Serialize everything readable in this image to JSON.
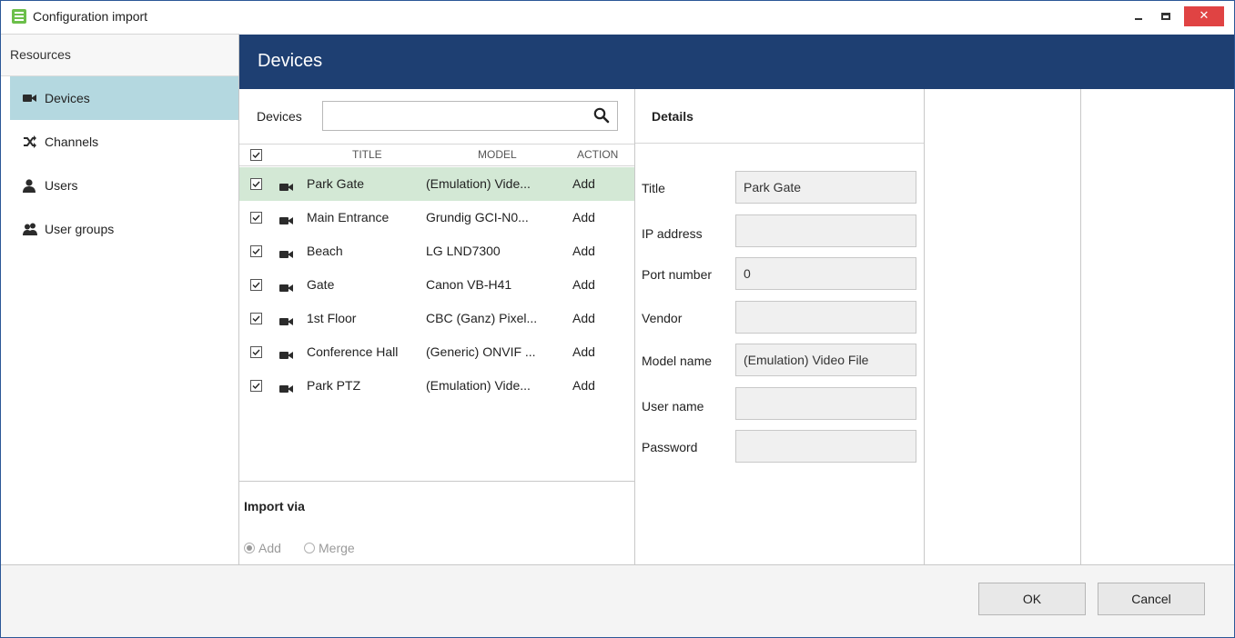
{
  "window": {
    "title": "Configuration import",
    "close_glyph": "✕"
  },
  "sidebar": {
    "header": "Resources",
    "items": [
      {
        "label": "Devices",
        "icon": "camera-icon"
      },
      {
        "label": "Channels",
        "icon": "shuffle-icon"
      },
      {
        "label": "Users",
        "icon": "user-icon"
      },
      {
        "label": "User groups",
        "icon": "user-group-icon"
      }
    ]
  },
  "main": {
    "title": "Devices"
  },
  "devices": {
    "search_label": "Devices",
    "search_value": "",
    "columns": {
      "title": "TITLE",
      "model": "MODEL",
      "action": "ACTION"
    },
    "rows": [
      {
        "title": "Park Gate",
        "model": "(Emulation) Vide...",
        "action": "Add"
      },
      {
        "title": "Main Entrance",
        "model": "Grundig GCI-N0...",
        "action": "Add"
      },
      {
        "title": "Beach",
        "model": "LG LND7300",
        "action": "Add"
      },
      {
        "title": "Gate",
        "model": "Canon VB-H41",
        "action": "Add"
      },
      {
        "title": "1st Floor",
        "model": "CBC (Ganz) Pixel...",
        "action": "Add"
      },
      {
        "title": "Conference Hall",
        "model": "(Generic) ONVIF ...",
        "action": "Add"
      },
      {
        "title": "Park PTZ",
        "model": "(Emulation) Vide...",
        "action": "Add"
      }
    ],
    "import": {
      "title": "Import via",
      "add_label": "Add",
      "merge_label": "Merge",
      "selected": "Add"
    }
  },
  "details": {
    "title": "Details",
    "fields": [
      {
        "label": "Title",
        "value": "Park Gate"
      },
      {
        "label": "IP address",
        "value": ""
      },
      {
        "label": "Port number",
        "value": "0"
      },
      {
        "label": "Vendor",
        "value": ""
      },
      {
        "label": "Model name",
        "value": "(Emulation) Video File"
      },
      {
        "label": "User name",
        "value": ""
      },
      {
        "label": "Password",
        "value": ""
      }
    ]
  },
  "footer": {
    "ok_label": "OK",
    "cancel_label": "Cancel"
  },
  "colors": {
    "header_bg": "#1e3f72",
    "sidebar_active": "#b4d8e0",
    "row_selected": "#d3e8d5",
    "close_button": "#e04343"
  }
}
